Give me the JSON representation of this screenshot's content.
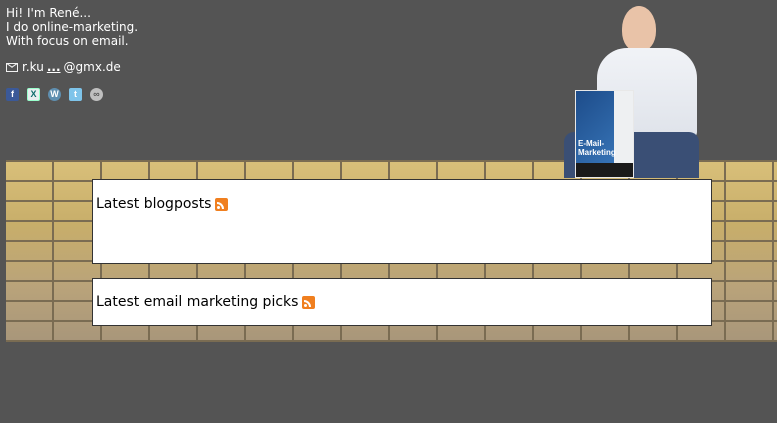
{
  "intro": {
    "line1": "Hi! I'm René...",
    "line2": "I do online-marketing.",
    "line3": "With focus on email."
  },
  "contact": {
    "email_prefix": "r.ku",
    "email_dots": "...",
    "email_suffix": "@gmx.de",
    "icon": "envelope-icon"
  },
  "social": [
    {
      "name": "facebook-icon",
      "glyph": "f"
    },
    {
      "name": "xing-icon",
      "glyph": "X"
    },
    {
      "name": "wordpress-icon",
      "glyph": "W"
    },
    {
      "name": "twitter-icon",
      "glyph": "t"
    },
    {
      "name": "link-icon",
      "glyph": "∞"
    }
  ],
  "book": {
    "title": "E-Mail-Marketing"
  },
  "sections": {
    "blogposts_title": "Latest blogposts",
    "picks_title": "Latest email marketing picks"
  },
  "colors": {
    "background": "#545454",
    "rss": "#f07f1f"
  }
}
